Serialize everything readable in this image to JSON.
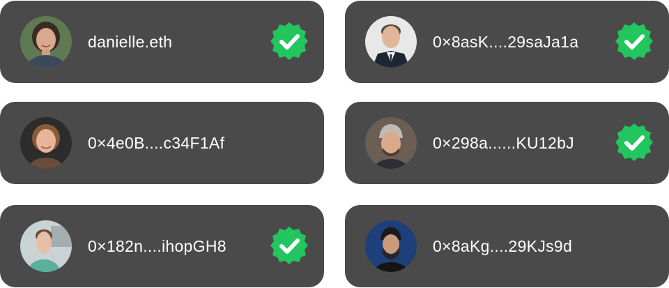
{
  "accounts": [
    {
      "address": "danielle.eth",
      "verified": true,
      "avatar_icon": "person-portrait-woman-curly-hair",
      "avatar_bg": "#5f7a52"
    },
    {
      "address": "0×8asK....29saJa1a",
      "verified": true,
      "avatar_icon": "person-portrait-man-suit",
      "avatar_bg": "#e8e8e8"
    },
    {
      "address": "0×4e0B....c34F1Af",
      "verified": false,
      "avatar_icon": "person-portrait-woman-short-hair",
      "avatar_bg": "#2c2c2c"
    },
    {
      "address": "0×298a......KU12bJ",
      "verified": true,
      "avatar_icon": "person-portrait-man-beanie",
      "avatar_bg": "#6b5e55"
    },
    {
      "address": "0×182n....ihopGH8",
      "verified": true,
      "avatar_icon": "person-portrait-young-man",
      "avatar_bg": "#c9d3d6"
    },
    {
      "address": "0×8aKg....29KJs9d",
      "verified": false,
      "avatar_icon": "person-portrait-man-dark-beanie",
      "avatar_bg": "#1d3f7a"
    }
  ],
  "colors": {
    "card_bg": "#4a4a4a",
    "text": "#ffffff",
    "verified_badge": "#22c55e",
    "page_bg": "#ffffff"
  }
}
